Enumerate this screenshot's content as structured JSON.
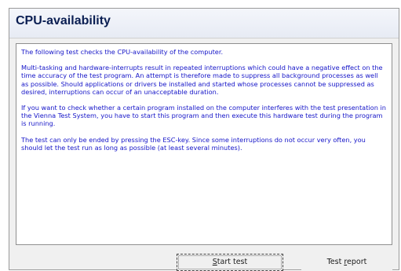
{
  "window": {
    "title": "CPU-availability"
  },
  "content": {
    "paragraphs": [
      "The following test checks the CPU-availability of the computer.",
      "Multi-tasking and hardware-interrupts result in repeated interruptions which could have a negative effect on the time accuracy of the test program. An attempt is therefore made to suppress all background processes as well as possible. Should applications or drivers be installed and started whose processes cannot be suppressed as desired, interruptions can occur of an unacceptable duration.",
      "If you want to check whether a certain program installed on the computer interferes with the test presentation in the Vienna Test System, you have to start this program and then execute this hardware test during the program is running.",
      "The test can only be ended by pressing the ESC-key. Since some interruptions do not occur very often, you should let the test run as long as possible (at least several minutes)."
    ]
  },
  "buttons": {
    "start_test": {
      "accel": "S",
      "rest": "tart test"
    },
    "test_report": {
      "pre": "Test ",
      "accel": "r",
      "rest": "eport"
    }
  },
  "colors": {
    "text": "#1515c8",
    "title": "#0a1e52"
  }
}
